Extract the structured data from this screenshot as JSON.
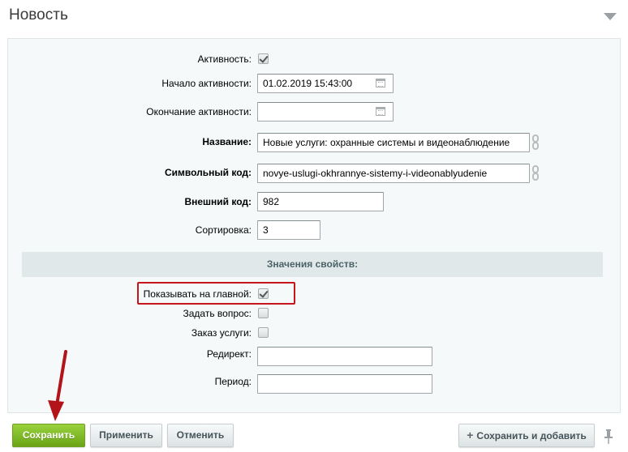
{
  "header": {
    "title": "Новость"
  },
  "form": {
    "active_label": "Активность:",
    "active_checked": true,
    "start_label": "Начало активности:",
    "start_value": "01.02.2019 15:43:00",
    "end_label": "Окончание активности:",
    "end_value": "",
    "name_label": "Название:",
    "name_value": "Новые услуги: охранные системы и видеонаблюдение",
    "code_label": "Символьный код:",
    "code_value": "novye-uslugi-okhrannye-sistemy-i-videonablyudenie",
    "external_label": "Внешний код:",
    "external_value": "982",
    "sort_label": "Сортировка:",
    "sort_value": "3"
  },
  "properties": {
    "section_title": "Значения свойств:",
    "show_main_label": "Показывать на главной:",
    "show_main_checked": true,
    "ask_label": "Задать вопрос:",
    "ask_checked": false,
    "order_label": "Заказ услуги:",
    "order_checked": false,
    "redirect_label": "Редирект:",
    "redirect_value": "",
    "period_label": "Период:",
    "period_value": ""
  },
  "buttons": {
    "save": "Сохранить",
    "apply": "Применить",
    "cancel": "Отменить",
    "save_add": "Сохранить и добавить"
  },
  "icons": {
    "collapse": "triangle-down-icon",
    "calendar": "calendar-icon",
    "link": "chain-link-icon",
    "plus": "plus-icon",
    "pin": "pin-icon"
  },
  "colors": {
    "primary_button": "#7ab828",
    "highlight": "#c4161c",
    "section_bar": "#e0e8ea",
    "panel": "#f5f9f9"
  }
}
